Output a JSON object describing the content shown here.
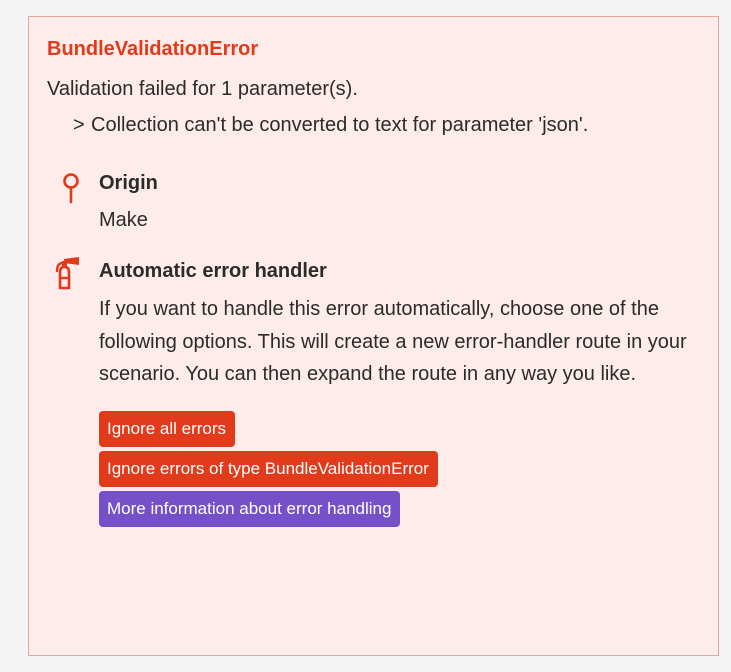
{
  "error": {
    "title": "BundleValidationError",
    "message": "Validation failed for 1 parameter(s).",
    "detail_chevron": ">",
    "detail": "Collection can't be converted to text for parameter 'json'."
  },
  "origin": {
    "icon": "location-pin-icon",
    "title": "Origin",
    "value": "Make"
  },
  "handler": {
    "icon": "fire-extinguisher-icon",
    "title": "Automatic error handler",
    "description": "If you want to handle this error automatically, choose one of the following options. This will create a new error-handler route in your scenario. You can then expand the route in any way you like.",
    "buttons": {
      "ignore_all": "Ignore all errors",
      "ignore_type": "Ignore errors of type BundleValidationError",
      "more_info": "More information about error handling"
    }
  },
  "colors": {
    "accent": "#e13a1b",
    "panel_background": "#fdecea",
    "panel_border": "#e7a59a",
    "info_button": "#7550c9"
  }
}
